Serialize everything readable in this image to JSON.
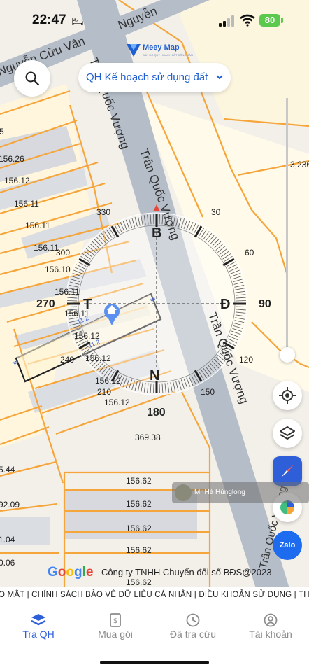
{
  "status_bar": {
    "time": "22:47",
    "battery": "80"
  },
  "header": {
    "brand": "Meey Map",
    "brand_sub": "BẢN ĐỒ QUY HOẠCH BẤT ĐỘNG SẢN",
    "layer_select": "QH Kế hoạch sử dụng đất"
  },
  "map": {
    "roads": [
      "Nguyễn Cửu Vân",
      "Nguyễn",
      "Trần Quốc Vượng",
      "Trần Quốc Vượng",
      "Trần Quốc Vượng"
    ],
    "labels": [
      "5",
      "156.26",
      "156.12",
      "156.11",
      "156.11",
      "156.11",
      "156.10",
      "156.11",
      "156.11",
      "156.12",
      "156.12",
      "156.12",
      "156.12",
      "369.38",
      "3,236",
      "156.62",
      "156.62",
      "156.62",
      "156.62",
      "156.62",
      "5.44",
      "92.09",
      "1.04",
      "0.06",
      "11.2",
      "11.2",
      "5",
      "5"
    ]
  },
  "compass": {
    "n": "B",
    "e": "Đ",
    "s": "N",
    "w": "T",
    "deg": [
      "330",
      "30",
      "60",
      "300",
      "270",
      "90",
      "240",
      "120",
      "210",
      "150",
      "180"
    ]
  },
  "toast": {
    "text": "Mr Hà Hùnglong"
  },
  "footer": {
    "google": "Google",
    "copyright": "Công ty TNHH Chuyển đổi số BĐS@2023",
    "ticker": "O MẬT  |  CHÍNH SÁCH BẢO VỆ DỮ LIỆU CÁ NHÂN  |  ĐIỀU KHOẢN SỬ DỤNG  |  THÔN"
  },
  "zalo": "Zalo",
  "tabs": [
    {
      "label": "Tra QH",
      "active": true
    },
    {
      "label": "Mua gói",
      "active": false
    },
    {
      "label": "Đã tra cứu",
      "active": false
    },
    {
      "label": "Tài khoản",
      "active": false
    }
  ],
  "colors": {
    "accent": "#2f5fd8",
    "road": "#b4bdc9",
    "parcel": "#f7a93a",
    "brand": "#1f5fd1"
  }
}
